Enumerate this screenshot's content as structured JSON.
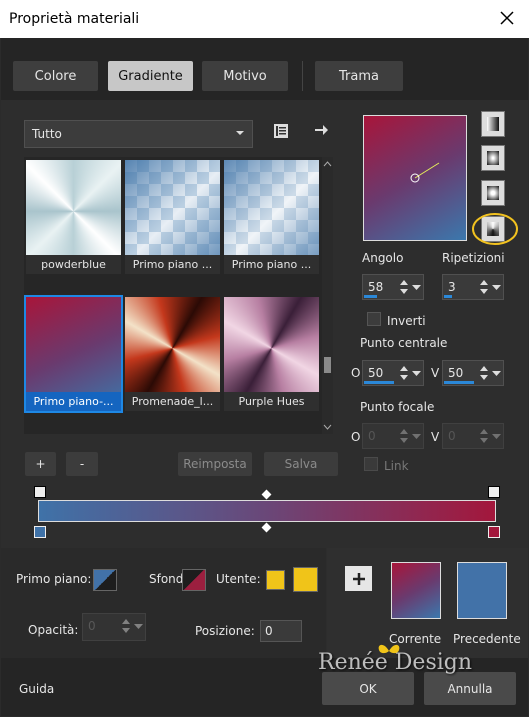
{
  "window": {
    "title": "Proprietà materiali"
  },
  "tabs": [
    {
      "label": "Colore"
    },
    {
      "label": "Gradiente"
    },
    {
      "label": "Motivo"
    },
    {
      "label": "Trama"
    }
  ],
  "category": {
    "selected": "Tutto"
  },
  "gradients": [
    {
      "label": "powderblue"
    },
    {
      "label": "Primo piano ..."
    },
    {
      "label": "Primo piano ..."
    },
    {
      "label": "Primo piano-..."
    },
    {
      "label": "Promenade_l..."
    },
    {
      "label": "Purple Hues"
    }
  ],
  "gradient_buttons": {
    "add": "+",
    "remove": "-",
    "reset": "Reimposta",
    "save": "Salva"
  },
  "angle": {
    "label": "Angolo",
    "value": "58"
  },
  "repeats": {
    "label": "Ripetizioni",
    "value": "3"
  },
  "invert": {
    "label": "Inverti",
    "checked": false
  },
  "center": {
    "label": "Punto centrale",
    "h_letter": "O",
    "h_value": "50",
    "v_letter": "V",
    "v_value": "50"
  },
  "focal": {
    "label": "Punto focale",
    "h_letter": "O",
    "h_value": "0",
    "v_letter": "V",
    "v_value": "0"
  },
  "link": {
    "label": "Link"
  },
  "colors": {
    "fg_label": "Primo piano:",
    "bg_label": "Sfondo:",
    "user_label": "Utente:",
    "accent_blue": "#4272a8",
    "accent_red": "#9c1f3f",
    "user_yellow": "#f0c419"
  },
  "opacity": {
    "label": "Opacità:",
    "value": "0"
  },
  "position": {
    "label": "Posizione:",
    "value": "0"
  },
  "preview": {
    "current_label": "Corrente",
    "previous_label": "Precedente"
  },
  "watermark": "Renée Design",
  "footer": {
    "help": "Guida",
    "ok": "OK",
    "cancel": "Annulla"
  }
}
